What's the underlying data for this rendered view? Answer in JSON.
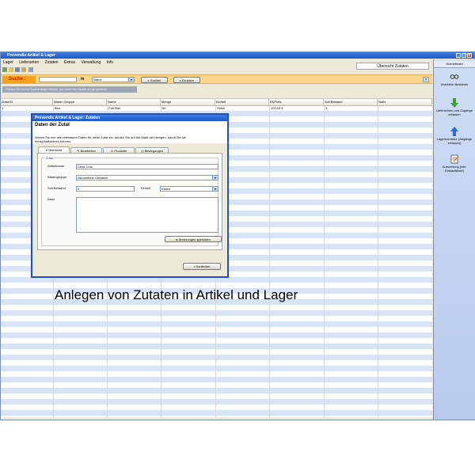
{
  "window": {
    "title": "Provendis Artikel & Lager"
  },
  "menu": [
    "Lager",
    "Lieferanten",
    "Zutaten",
    "Extras",
    "Verwaltung",
    "Info"
  ],
  "overview_button": "Übersicht Zutaten",
  "search": {
    "label": "Suche :",
    "value": "",
    "in_label": "in",
    "field": "Name",
    "search_button": "Suchen",
    "print_button": "Drucken"
  },
  "group_hint": "Ziehen Sie einen Spaltenkopf hierher, um nach der Spalte zu gruppieren",
  "grid": {
    "columns": [
      "Zutat ID",
      "Waren Gruppe",
      "Name",
      "Menge",
      "Einheit",
      "EKPreis",
      "Soll Bestand",
      "Notiz"
    ],
    "rows": [
      [
        "1",
        "Bier",
        "Faß Bier",
        "50",
        "Stück",
        "120,00 €",
        "3",
        ""
      ]
    ]
  },
  "quickbar": {
    "title": "Schnellwahl",
    "items": [
      {
        "label": "Überblick Bestände",
        "icon": "glasses-icon"
      },
      {
        "label": "Lieferschein und Zugänge erfassen",
        "icon": "arrow-down-icon"
      },
      {
        "label": "Lagerkorrektur (Abgänge erfassen)",
        "icon": "arrow-up-icon"
      },
      {
        "label": "Auswertung (inkl. Einkaufsliste)",
        "icon": "notepad-icon"
      }
    ]
  },
  "dialog": {
    "title": "Provendis Artikel & Lager: Zutaten",
    "heading": "Daten der Zutat",
    "description": "Geben Sie hier alle relevanten Daten für diese Zutat ein. Achten Sie auf die Wahl der Mengen, damit Sie sie richtig kalkulieren können.",
    "tabs": [
      "Übersicht",
      "Bearbeiten",
      "Produkte",
      "Bewegungen"
    ],
    "group_label": "Zutat",
    "fields": {
      "name_label": "Artikelname",
      "name_value": "Coca Cola",
      "group_label": "Warengruppe",
      "group_value": "Alkoholfreie Getränke",
      "stock_label": "Soll-Bestand",
      "stock_value": "0",
      "unit_label": "Einheit",
      "unit_value": "Kisten",
      "note_label": "Notiz"
    },
    "save_button": "Änderungen speichern",
    "close_button": "Schließen"
  },
  "caption": "Anlegen von Zutaten in Artikel und Lager",
  "colors": {
    "titlebar": "#1f56c6",
    "search_bar": "#fbd58a",
    "row_alt": "#d9e3f6",
    "quickbar": "#c4d4f4"
  }
}
